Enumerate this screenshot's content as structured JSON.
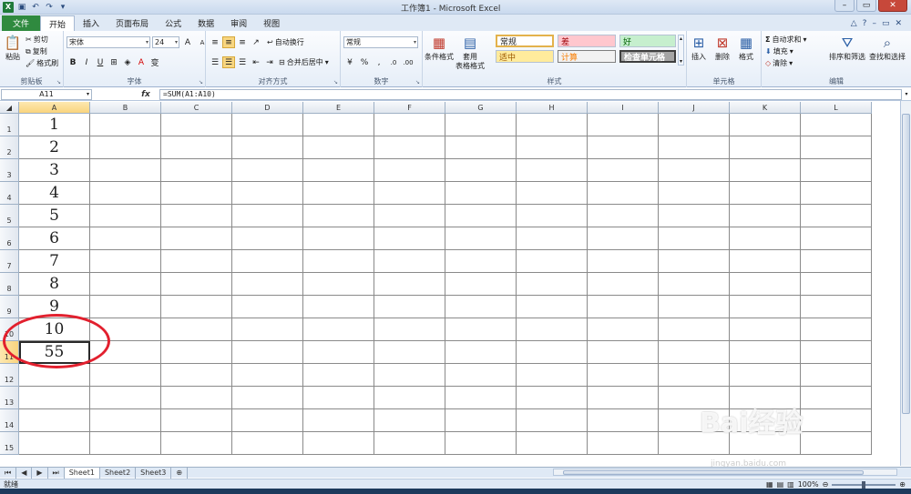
{
  "window": {
    "title": "工作簿1 - Microsoft Excel"
  },
  "tabs": [
    "文件",
    "开始",
    "插入",
    "页面布局",
    "公式",
    "数据",
    "审阅",
    "视图"
  ],
  "ribbon": {
    "clipboard": {
      "paste": "粘贴",
      "cut": "剪切",
      "copy": "复制",
      "format_painter": "格式刷",
      "label": "剪贴板"
    },
    "font": {
      "name": "宋体",
      "size": "24",
      "label": "字体"
    },
    "alignment": {
      "wrap": "自动换行",
      "merge": "合并后居中",
      "label": "对齐方式"
    },
    "number": {
      "format": "常规",
      "label": "数字"
    },
    "styles": {
      "cond": "条件格式",
      "table_l1": "套用",
      "table_l2": "表格格式",
      "normal": "常规",
      "bad": "差",
      "good": "好",
      "neutral": "适中",
      "calc": "计算",
      "check": "检查单元格",
      "label": "样式"
    },
    "cells": {
      "insert": "插入",
      "delete": "删除",
      "format": "格式",
      "label": "单元格"
    },
    "editing": {
      "autosum": "自动求和",
      "fill": "填充",
      "clear": "清除",
      "sort": "排序和筛选",
      "find": "查找和选择",
      "label": "编辑"
    }
  },
  "formula_bar": {
    "name_box": "A11",
    "formula": "=SUM(A1:A10)"
  },
  "columns": [
    "A",
    "B",
    "C",
    "D",
    "E",
    "F",
    "G",
    "H",
    "I",
    "J",
    "K",
    "L"
  ],
  "rows": [
    "1",
    "2",
    "3",
    "4",
    "5",
    "6",
    "7",
    "8",
    "9",
    "10",
    "11",
    "12",
    "13",
    "14",
    "15"
  ],
  "cells_a": [
    "1",
    "2",
    "3",
    "4",
    "5",
    "6",
    "7",
    "8",
    "9",
    "10",
    "55"
  ],
  "sheet_tabs": [
    "Sheet1",
    "Sheet2",
    "Sheet3"
  ],
  "status": {
    "ready": "就绪",
    "zoom": "100%"
  },
  "watermark": {
    "brand": "Bai经验",
    "url": "jingyan.baidu.com"
  }
}
